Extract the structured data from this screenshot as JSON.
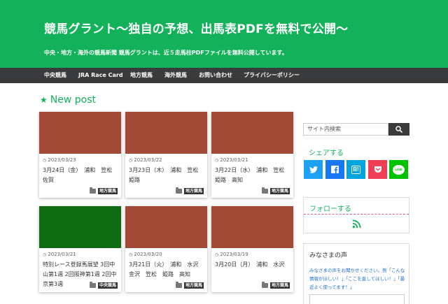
{
  "header": {
    "title": "競馬グラント〜独自の予想、出馬表PDFを無料で公開〜",
    "description": "中央・地方・海外の競馬新聞 競馬グラントは、近５走馬柱PDFファイルを無料公開しています。",
    "bg_color": "#13b15a"
  },
  "nav": {
    "items": [
      {
        "label": "中央競馬"
      },
      {
        "label": "JRA Race Card"
      },
      {
        "label": "地方競馬"
      },
      {
        "label": "海外競馬"
      },
      {
        "label": "お問い合わせ"
      },
      {
        "label": "プライバシーポリシー"
      }
    ]
  },
  "main": {
    "section_title": "New post",
    "section_icon": "star-icon",
    "posts": [
      {
        "date": "2023/03/23",
        "title": "3月24日（金）　浦和　笠松　佐賀",
        "category": "地方競馬",
        "thumb_color": "#a24a35"
      },
      {
        "date": "2023/03/22",
        "title": "3月23日（木）　浦和　笠松　姫路",
        "category": "地方競馬",
        "thumb_color": "#a24a35"
      },
      {
        "date": "2023/03/21",
        "title": "3月22日（水）　浦和　笠松　姫路　高知",
        "category": "地方競馬",
        "thumb_color": "#a24a35"
      },
      {
        "date": "2023/03/21",
        "title": "特別レース登録馬展望 3回中山第1週 2回阪神第1週 2回中京第3週",
        "category": "中央競馬",
        "thumb_color": "#0e6b12"
      },
      {
        "date": "2023/03/20",
        "title": "3月21日（火）　浦和　水沢　金沢　笠松　姫路　高知",
        "category": "地方競馬",
        "thumb_color": "#a24a35"
      },
      {
        "date": "2023/03/19",
        "title": "3月20日（月）　浦和　水沢",
        "category": "地方競馬",
        "thumb_color": "#a24a35"
      }
    ]
  },
  "sidebar": {
    "search_placeholder": "サイト内検索",
    "share_title": "シェアする",
    "share_buttons": [
      {
        "name": "twitter",
        "color": "#1da1f2"
      },
      {
        "name": "facebook",
        "color": "#1877f2"
      },
      {
        "name": "hatena",
        "label": "B!",
        "color": "#00a4de"
      },
      {
        "name": "pocket",
        "color": "#ef3f56"
      },
      {
        "name": "line",
        "label": "LINE",
        "color": "#00c300"
      }
    ],
    "follow_title": "フォローする",
    "voice_title": "みなさまの声",
    "voice_text": "みなさまの声をお聞かせください。例「こんな情報がほしい！」「ここを直してほしい！」「最近よく使ってます！」"
  }
}
